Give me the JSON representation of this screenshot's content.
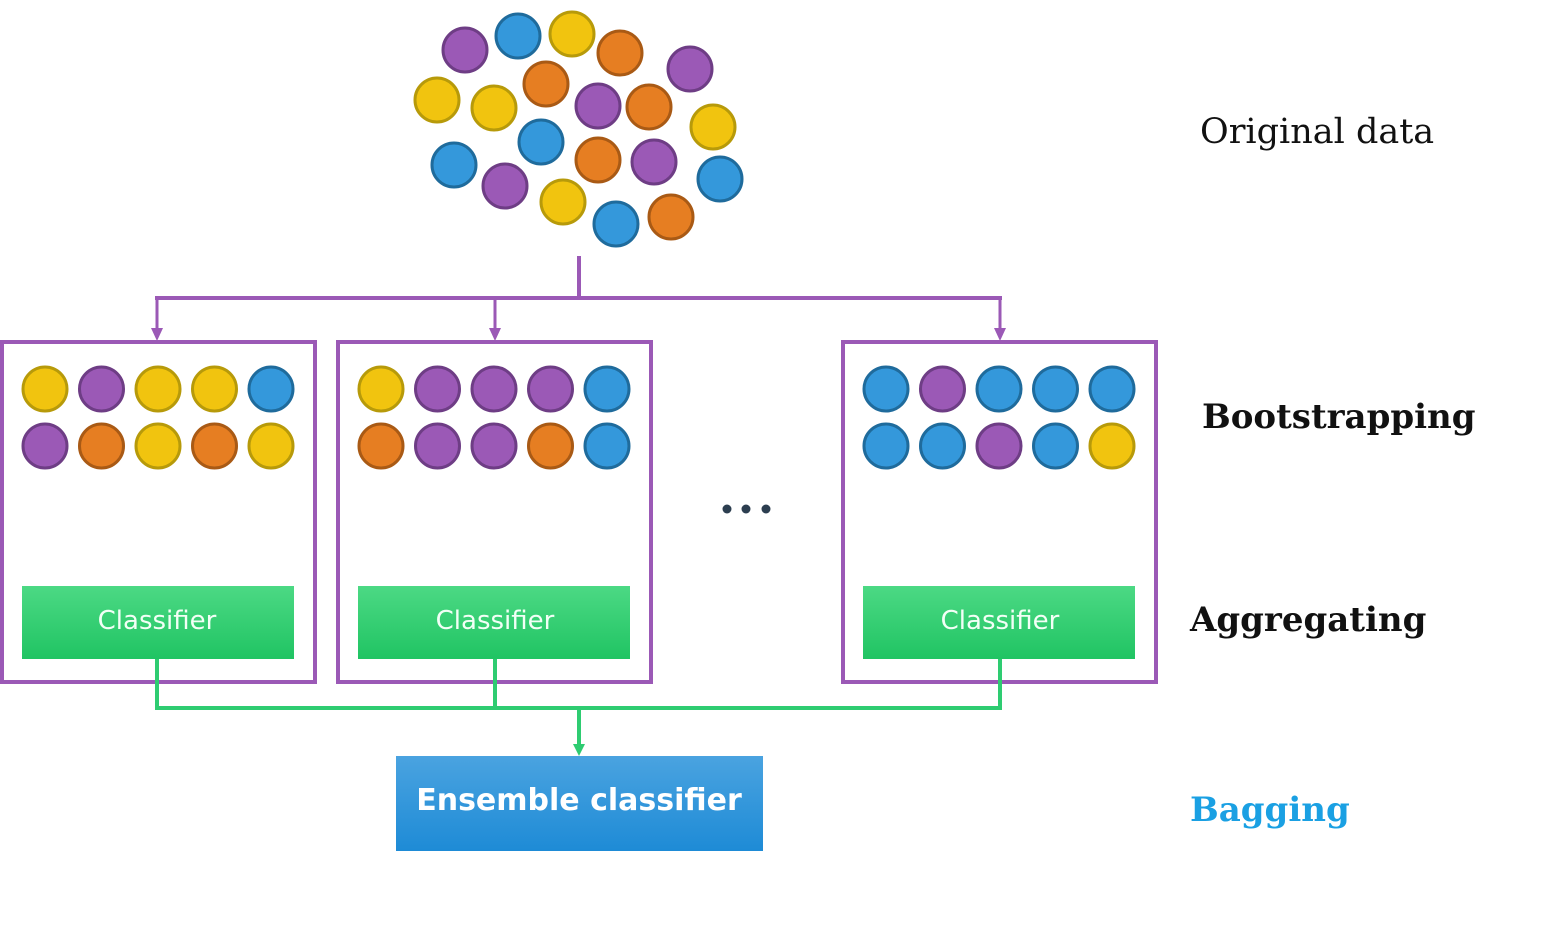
{
  "colors": {
    "purple": {
      "fill": "#9b59b6",
      "stroke": "#6e3d85"
    },
    "blue": {
      "fill": "#3498db",
      "stroke": "#1f6b9c"
    },
    "yellow": {
      "fill": "#f1c40f",
      "stroke": "#b79a0a"
    },
    "orange": {
      "fill": "#e67e22",
      "stroke": "#a95a15"
    },
    "flow_purple": "#9b59b6",
    "flow_green": "#2ecc71",
    "classifier_top": "#4cd984",
    "classifier_bottom": "#20c463",
    "ensemble_top": "#4aa3e0",
    "ensemble_bottom": "#1e8bd6",
    "dots": "#2c3e50",
    "bagging_label": "#1aa0e3"
  },
  "original_data": {
    "label": "Original data",
    "samples": [
      "purple",
      "blue",
      "yellow",
      "orange",
      "purple",
      "yellow",
      "yellow",
      "orange",
      "purple",
      "orange",
      "yellow",
      "blue",
      "blue",
      "orange",
      "purple",
      "blue",
      "purple",
      "yellow",
      "blue",
      "orange"
    ]
  },
  "bootstrap_samples": [
    {
      "row1": [
        "yellow",
        "purple",
        "yellow",
        "yellow",
        "blue"
      ],
      "row2": [
        "purple",
        "orange",
        "yellow",
        "orange",
        "yellow"
      ],
      "classifier_label": "Classifier"
    },
    {
      "row1": [
        "yellow",
        "purple",
        "purple",
        "purple",
        "blue"
      ],
      "row2": [
        "orange",
        "purple",
        "purple",
        "orange",
        "blue"
      ],
      "classifier_label": "Classifier"
    },
    {
      "row1": [
        "blue",
        "purple",
        "blue",
        "blue",
        "blue"
      ],
      "row2": [
        "blue",
        "blue",
        "purple",
        "blue",
        "yellow"
      ],
      "classifier_label": "Classifier"
    }
  ],
  "ellipsis": "more bootstrap samples",
  "stages": {
    "bootstrapping": "Bootstrapping",
    "aggregating": "Aggregating",
    "bagging": "Bagging"
  },
  "ensemble": {
    "label": "Ensemble classifier"
  }
}
